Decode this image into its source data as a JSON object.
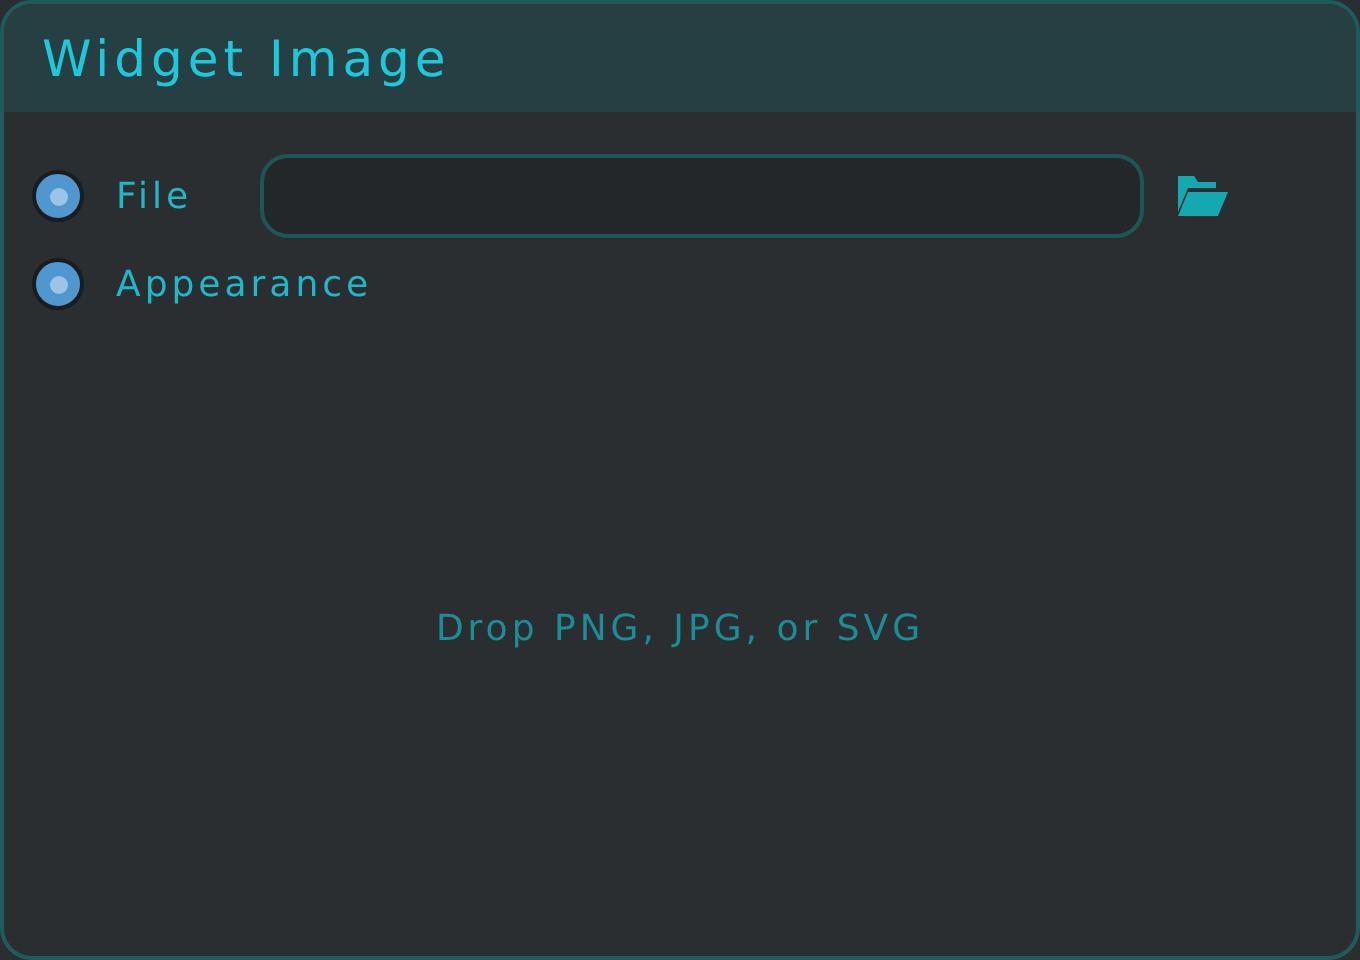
{
  "window": {
    "title": "Widget Image"
  },
  "options": [
    {
      "label": "File",
      "selected": true,
      "kind": "file"
    },
    {
      "label": "Appearance",
      "selected": true,
      "kind": "plain"
    }
  ],
  "drop_hint": "Drop PNG, JPG, or SVG"
}
